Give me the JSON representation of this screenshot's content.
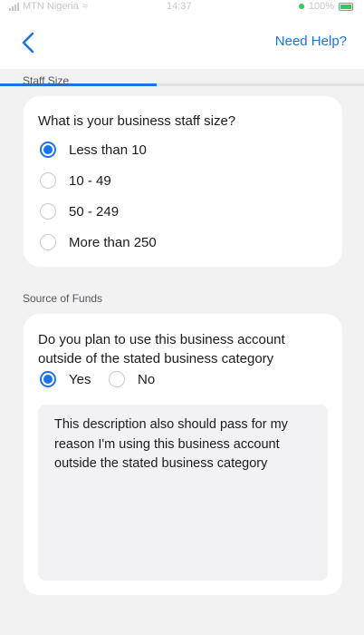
{
  "status_bar": {
    "carrier": "MTN Nigeria",
    "time": "14:37",
    "battery": "100%"
  },
  "nav": {
    "help_label": "Need Help?",
    "back_icon": "chevron-left-icon",
    "progress": 0.43
  },
  "colors": {
    "accent": "#1a73e8",
    "background": "#f2f2f3",
    "card": "#ffffff"
  },
  "staff_size": {
    "section_label": "Staff Size",
    "question": "What is your business staff size?",
    "options": [
      {
        "label": "Less than 10",
        "selected": true
      },
      {
        "label": "10 - 49",
        "selected": false
      },
      {
        "label": "50 - 249",
        "selected": false
      },
      {
        "label": "More than 250",
        "selected": false
      }
    ]
  },
  "source_of_funds": {
    "section_label": "Source of Funds",
    "question_line1": "Do you plan to use this business account",
    "question_line2": "outside of the stated business category",
    "options": [
      {
        "label": "Yes",
        "selected": true
      },
      {
        "label": "No",
        "selected": false
      }
    ],
    "description": "This description also should pass for my reason I'm using this business account outside the stated business category"
  }
}
